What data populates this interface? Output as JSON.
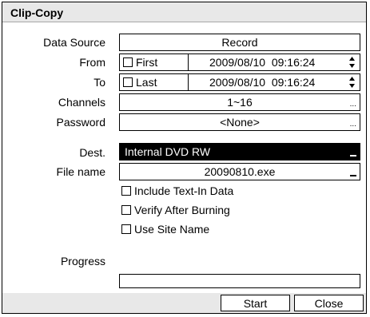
{
  "dialog": {
    "title": "Clip-Copy"
  },
  "data_source": {
    "label": "Data Source",
    "value": "Record"
  },
  "from": {
    "label": "From",
    "checkbox_label": "First",
    "checked": false,
    "datetime": "2009/08/10  09:16:24"
  },
  "to": {
    "label": "To",
    "checkbox_label": "Last",
    "checked": false,
    "datetime": "2009/08/10  09:16:24"
  },
  "channels": {
    "label": "Channels",
    "value": "1~16"
  },
  "password": {
    "label": "Password",
    "value": "<None>"
  },
  "dest": {
    "label": "Dest.",
    "value": "Internal DVD RW"
  },
  "file_name": {
    "label": "File name",
    "value": "20090810.exe"
  },
  "options": [
    {
      "label": "Include Text-In Data",
      "checked": false
    },
    {
      "label": "Verify After Burning",
      "checked": false
    },
    {
      "label": "Use Site Name",
      "checked": false
    }
  ],
  "progress": {
    "label": "Progress",
    "value": 0
  },
  "buttons": {
    "start": "Start",
    "close": "Close"
  },
  "icons": {
    "spinner": "up-down-arrows-icon",
    "ellipsis": "ellipsis-icon",
    "dropdown": "dropdown-underscore-icon"
  }
}
